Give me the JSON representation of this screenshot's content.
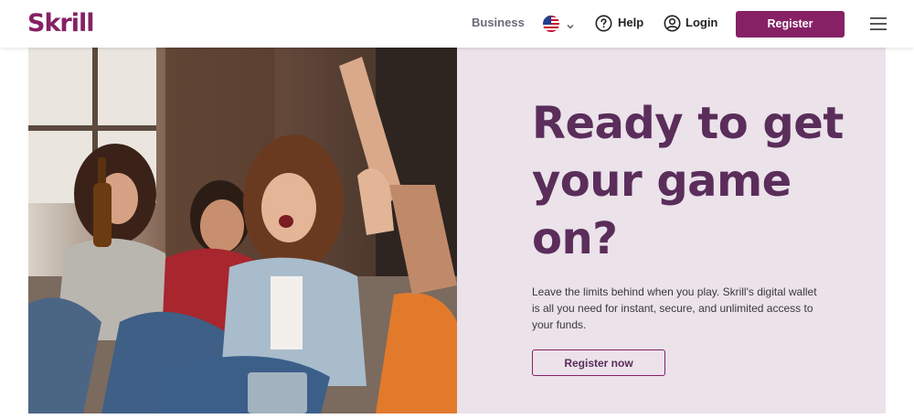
{
  "header": {
    "logo": "Skrill",
    "business_label": "Business",
    "flag_icon": "us-flag-icon",
    "help_label": "Help",
    "login_label": "Login",
    "register_label": "Register"
  },
  "hero": {
    "title": "Ready to get your game on?",
    "description": "Leave the limits behind when you play. Skrill's digital wallet is all you need for instant, secure, and unlimited access to your funds.",
    "cta_label": "Register now"
  },
  "colors": {
    "brand": "#862165",
    "hero_title": "#5a2d5a",
    "panel_bg": "#ebe2ea"
  }
}
